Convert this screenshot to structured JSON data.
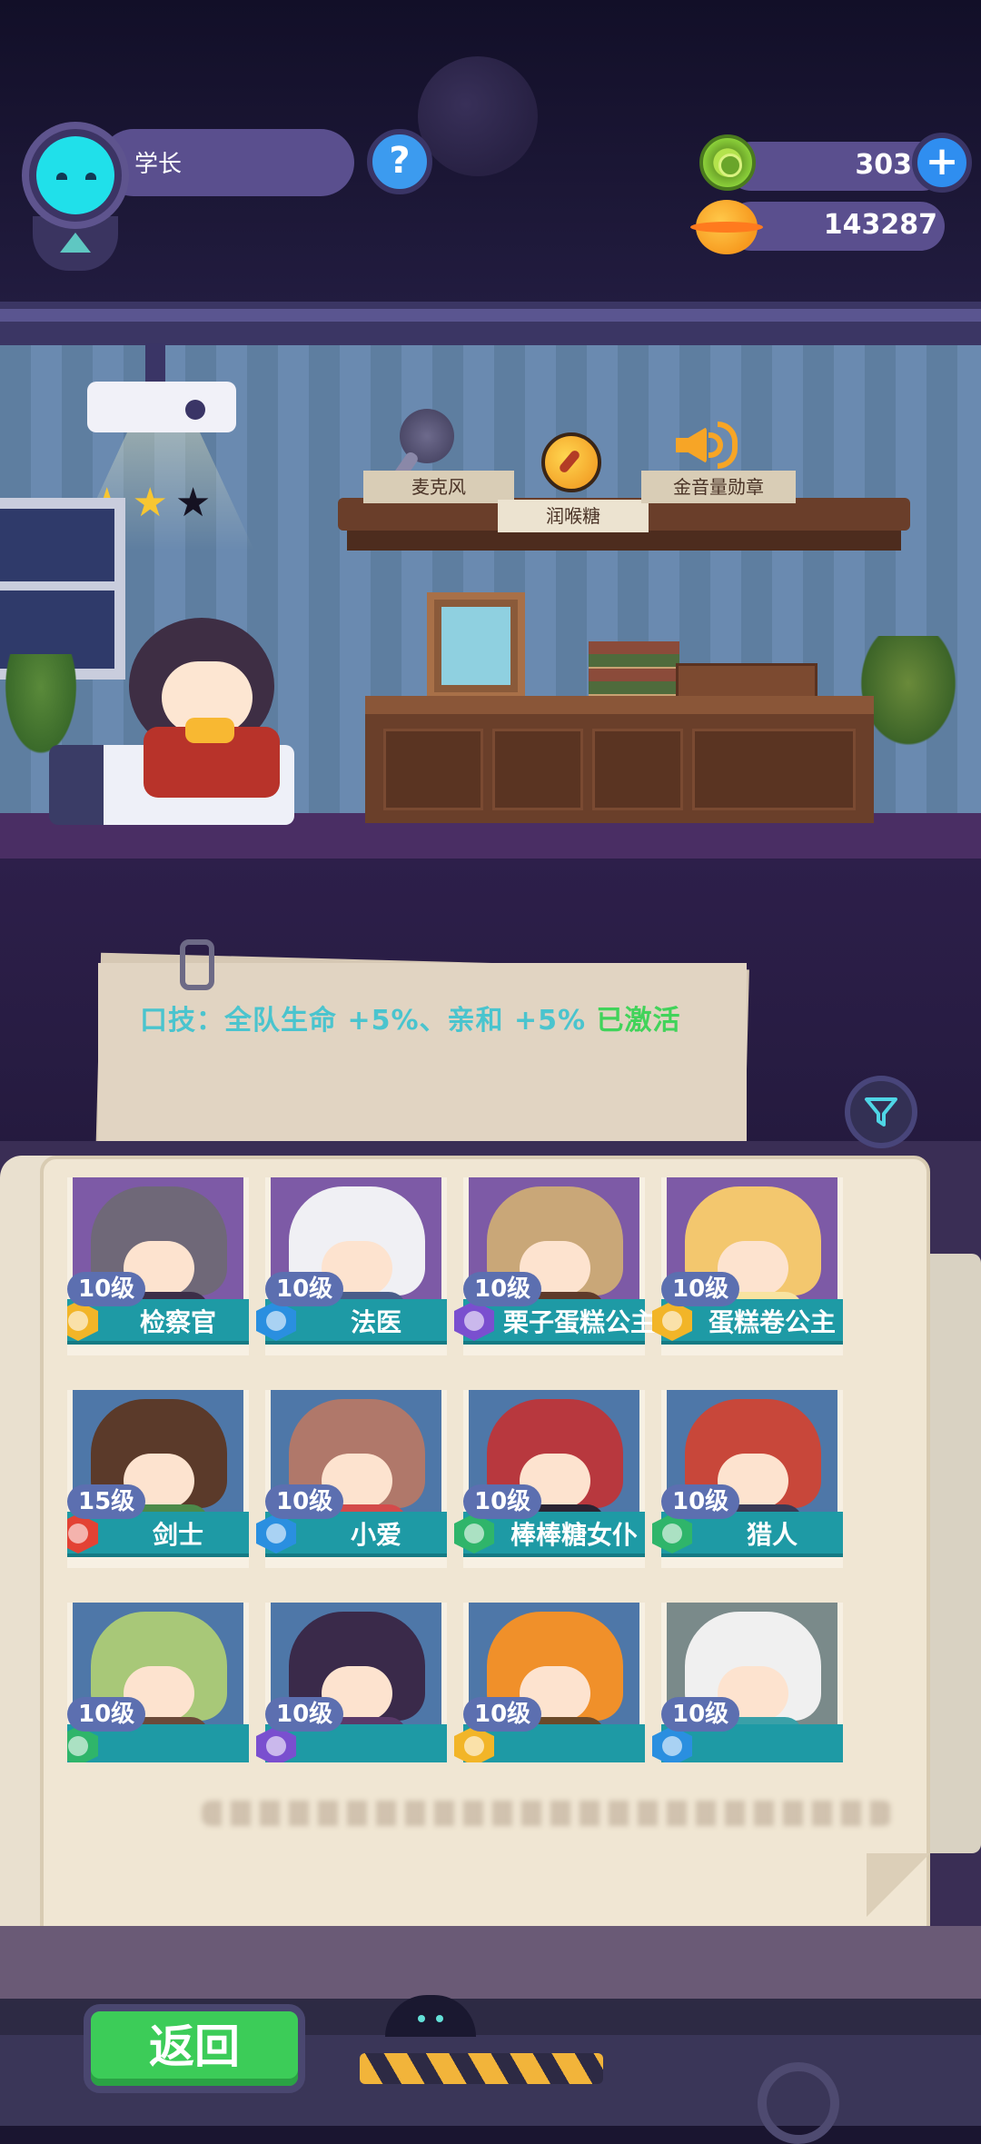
{
  "player": {
    "name": "学长",
    "help_symbol": "?"
  },
  "currency": {
    "gems": "303",
    "add_symbol": "+",
    "coins": "143287"
  },
  "room": {
    "stars": [
      "★",
      "★",
      "★"
    ],
    "stars_filled": 2,
    "shelf_items": [
      {
        "label": "麦克风",
        "icon": "microphone-icon",
        "selected": false
      },
      {
        "label": "润喉糖",
        "icon": "throat-candy-icon",
        "selected": true
      },
      {
        "label": "金音量勋章",
        "icon": "speaker-medal-icon",
        "selected": false
      }
    ]
  },
  "skill": {
    "text": "口技：全队生命 +5%、亲和 +5%",
    "status": "已激活"
  },
  "characters": [
    {
      "level": "10级",
      "name": "检察官",
      "badge_color": "#f2b528",
      "hair_color": "#6f6878",
      "body_color": "#3c2e48",
      "bg_color": "#7d5aa6"
    },
    {
      "level": "10级",
      "name": "法医",
      "badge_color": "#2a8fe0",
      "hair_color": "#f0f0f4",
      "body_color": "#4a5d8a",
      "bg_color": "#7d5aa6"
    },
    {
      "level": "10级",
      "name": "栗子蛋糕公主",
      "badge_color": "#7a4fcf",
      "hair_color": "#c9a778",
      "body_color": "#5f3b2a",
      "bg_color": "#7d5aa6"
    },
    {
      "level": "10级",
      "name": "蛋糕卷公主",
      "badge_color": "#f2b528",
      "hair_color": "#f3c76e",
      "body_color": "#f8e3a0",
      "bg_color": "#7d5aa6"
    },
    {
      "level": "15级",
      "name": "剑士",
      "badge_color": "#e34234",
      "hair_color": "#5b3a2a",
      "body_color": "#4c8a4a",
      "bg_color": "#4e77a8"
    },
    {
      "level": "10级",
      "name": "小爱",
      "badge_color": "#2a8fe0",
      "hair_color": "#b0786a",
      "body_color": "#d44a4a",
      "bg_color": "#4e77a8"
    },
    {
      "level": "10级",
      "name": "棒棒糖女仆",
      "badge_color": "#2fb56a",
      "hair_color": "#b8383e",
      "body_color": "#2a2433",
      "bg_color": "#4e77a8"
    },
    {
      "level": "10级",
      "name": "猎人",
      "badge_color": "#2fb56a",
      "hair_color": "#c8473a",
      "body_color": "#3a3a55",
      "bg_color": "#4e77a8"
    },
    {
      "level": "10级",
      "name": "",
      "badge_color": "#2fb56a",
      "hair_color": "#a8c878",
      "body_color": "#6a4a3a",
      "bg_color": "#4e77a8"
    },
    {
      "level": "10级",
      "name": "",
      "badge_color": "#7a4fcf",
      "hair_color": "#3a2a4a",
      "body_color": "#5a3a6a",
      "bg_color": "#4e77a8"
    },
    {
      "level": "10级",
      "name": "",
      "badge_color": "#f2b528",
      "hair_color": "#f0902a",
      "body_color": "#6a4a2a",
      "bg_color": "#4e77a8"
    },
    {
      "level": "10级",
      "name": "",
      "badge_color": "#2a8fe0",
      "hair_color": "#f0f0f0",
      "body_color": "#3aa0a8",
      "bg_color": "#7a8a8a"
    }
  ],
  "footer": {
    "back_label": "返回"
  },
  "colors": {
    "accent_teal": "#1e9aa5",
    "skill_text": "#4ac4ce",
    "skill_active": "#41d35a",
    "back_green": "#3ccc58"
  }
}
